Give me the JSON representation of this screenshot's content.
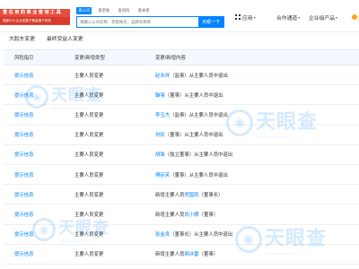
{
  "header": {
    "logo_line1": "查 在 用 的 商 业 查 询 工 具",
    "logo_line2": "国家中小企业发展子基金旗下机构",
    "search_tabs": [
      "查公司",
      "查老板",
      "查风险",
      "查关系"
    ],
    "search_placeholder": "请输入公司名称、老板姓名、品牌名称等",
    "search_button": "天眼一下",
    "nav": {
      "app": "应用",
      "coop": "合作通道",
      "enterprise": "企业级产品",
      "open_partial": "开"
    }
  },
  "subtabs": [
    "大股东变更",
    "最终受益人变更"
  ],
  "table": {
    "headers": [
      "风险指引",
      "变更/新增类型",
      "变更/新增内容"
    ],
    "rows": [
      {
        "risk": "提示信息",
        "type": "主要人员变更",
        "person": "赵永祥",
        "rest": "（监事）从主要人员中退出"
      },
      {
        "risk": "提示信息",
        "type": "主要人员变更",
        "person": "鞠强",
        "rest": "（董事）从主要人员中退出"
      },
      {
        "risk": "提示信息",
        "type": "主要人员变更",
        "person": "李玉杰",
        "rest": "（监事）从主要人员中退出"
      },
      {
        "risk": "提示信息",
        "type": "主要人员变更",
        "person": "刘权",
        "rest": "（董事）从主要人员中退出"
      },
      {
        "risk": "提示信息",
        "type": "主要人员变更",
        "person": "胡锋",
        "rest": "（独立董事）从主要人员中退出"
      },
      {
        "risk": "提示信息",
        "type": "主要人员变更",
        "person": "傅廷芙",
        "rest": "（董事）从主要人员中退出"
      },
      {
        "risk": "提示信息",
        "type": "主要人员变更",
        "prefix": "新增主要人员",
        "person": "郑国雨",
        "rest": "（董事长）"
      },
      {
        "risk": "提示信息",
        "type": "主要人员变更",
        "prefix": "新增主要人员",
        "person": "尚小娜",
        "rest": "（董事）"
      },
      {
        "risk": "提示信息",
        "type": "主要人员变更",
        "person": "张金良",
        "rest": "（董事长）从主要人员中退出"
      },
      {
        "risk": "提示信息",
        "type": "主要人员变更",
        "prefix": "新增主要人员",
        "person": "胡冰雷",
        "rest": "（董事）"
      }
    ]
  },
  "watermark": {
    "main": "天眼查",
    "sub": "TianYanCha.com"
  },
  "colors": {
    "accent": "#0084ff",
    "logo_red": "#e84c3d",
    "header_bg": "#f5f9ff"
  }
}
